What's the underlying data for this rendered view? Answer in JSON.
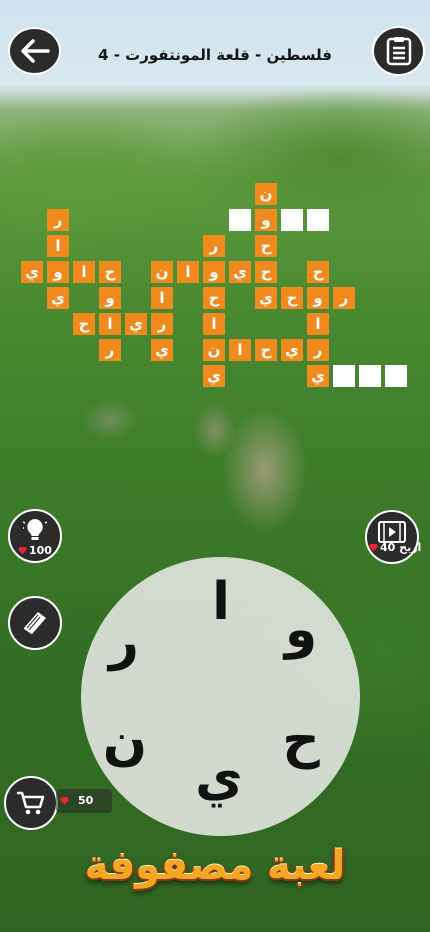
{
  "header": {
    "title": "فلسطين - قلعة المونتفورت - 4"
  },
  "tiles": [
    "ن",
    "و",
    "ر",
    "ا",
    "ر",
    "ح",
    "ي",
    "و",
    "ا",
    "ن",
    "ح",
    "ي",
    "ح",
    "ا",
    "و",
    "ي",
    "ح",
    "ا",
    "ح",
    "و",
    "ر",
    "ي",
    "و",
    "ا",
    "ح",
    "ر",
    "ي",
    "ا",
    "ي",
    "ر",
    "ر",
    "ي",
    "ن",
    "ا",
    "ح",
    "ر",
    "ي",
    "ي",
    "ي"
  ],
  "wheel_letters": [
    "ا",
    "و",
    "ر",
    "ح",
    "ن",
    "ي"
  ],
  "hint": {
    "cost": "100"
  },
  "video": {
    "label": "اربح 40"
  },
  "coins": {
    "value": "50"
  },
  "banner": {
    "title": "لعبة مصفوفة"
  },
  "colors": {
    "tile": "#f08a1c",
    "gem": "#e2262b"
  }
}
